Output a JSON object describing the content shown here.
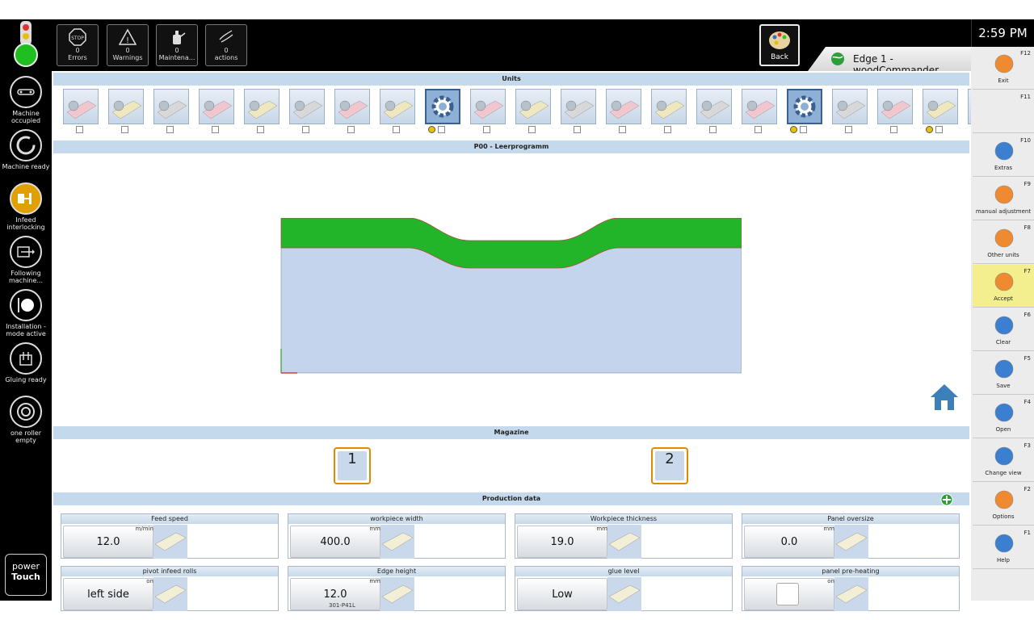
{
  "topbar": {
    "buttons": [
      {
        "icon": "stop-icon",
        "count": "0",
        "label": "Errors"
      },
      {
        "icon": "warning-icon",
        "count": "0",
        "label": "Warnings"
      },
      {
        "icon": "oilcan-icon",
        "count": "0",
        "label": "Maintena..."
      },
      {
        "icon": "hand-icon",
        "count": "0",
        "label": "actions"
      }
    ],
    "back_label": "Back",
    "window_tab": "Edge 1 - woodCommander",
    "clock": "2:59 PM"
  },
  "leftbar": {
    "items": [
      {
        "icon": "conveyor-icon",
        "label": "Machine occupied"
      },
      {
        "icon": "ready-ring-icon",
        "label": "Machine ready"
      },
      {
        "icon": "infeed-icon",
        "label": "Infeed interlocking"
      },
      {
        "icon": "following-machine-icon",
        "label": "Following machine..."
      },
      {
        "icon": "installation-icon",
        "label": "Installation - mode active"
      },
      {
        "icon": "glue-pot-icon",
        "label": "Gluing ready"
      },
      {
        "icon": "roller-icon",
        "label": "one roller empty"
      }
    ],
    "brand_line1": "power",
    "brand_line2": "Touch"
  },
  "main": {
    "units_title": "Units",
    "program_title": "P00 - Leerprogramm",
    "magazine_title": "Magazine",
    "magazines": [
      "1",
      "2"
    ],
    "production_title": "Production data",
    "tiles": [
      {
        "caption": "Feed speed",
        "unit": "m/min",
        "value": "12.0",
        "sub": ""
      },
      {
        "caption": "workpiece width",
        "unit": "mm",
        "value": "400.0",
        "sub": ""
      },
      {
        "caption": "Workpiece thickness",
        "unit": "mm",
        "value": "19.0",
        "sub": ""
      },
      {
        "caption": "Panel oversize",
        "unit": "mm",
        "value": "0.0",
        "sub": ""
      },
      {
        "caption": "pivot infeed rolls",
        "unit": "on",
        "value": "left side",
        "sub": ""
      },
      {
        "caption": "Edge height",
        "unit": "mm",
        "value": "12.0",
        "sub": "301-P41L"
      },
      {
        "caption": "glue level",
        "unit": "",
        "value": "Low",
        "sub": ""
      },
      {
        "caption": "panel pre-heating",
        "unit": "on",
        "value": "",
        "sub": ""
      }
    ]
  },
  "units": [
    {
      "selected": false,
      "dot": false
    },
    {
      "selected": false,
      "dot": false
    },
    {
      "selected": false,
      "dot": false
    },
    {
      "selected": false,
      "dot": false
    },
    {
      "selected": false,
      "dot": false
    },
    {
      "selected": false,
      "dot": false
    },
    {
      "selected": false,
      "dot": false
    },
    {
      "selected": false,
      "dot": false
    },
    {
      "selected": true,
      "dot": true
    },
    {
      "selected": false,
      "dot": false
    },
    {
      "selected": false,
      "dot": false
    },
    {
      "selected": false,
      "dot": false
    },
    {
      "selected": false,
      "dot": false
    },
    {
      "selected": false,
      "dot": false
    },
    {
      "selected": false,
      "dot": false
    },
    {
      "selected": false,
      "dot": false
    },
    {
      "selected": true,
      "dot": true
    },
    {
      "selected": false,
      "dot": false
    },
    {
      "selected": false,
      "dot": false
    },
    {
      "selected": false,
      "dot": true
    },
    {
      "selected": false,
      "dot": false
    }
  ],
  "rightbar": {
    "items": [
      {
        "key": "F12",
        "label": "Exit",
        "icon": "exit-icon"
      },
      {
        "key": "F11",
        "label": "",
        "icon": ""
      },
      {
        "key": "F10",
        "label": "Extras",
        "icon": "extras-icon"
      },
      {
        "key": "F9",
        "label": "manual adjustment",
        "icon": "manual-adjustment-icon"
      },
      {
        "key": "F8",
        "label": "Other units",
        "icon": "other-units-icon"
      },
      {
        "key": "F7",
        "label": "Accept",
        "icon": "accept-icon"
      },
      {
        "key": "F6",
        "label": "Clear",
        "icon": "clear-icon"
      },
      {
        "key": "F5",
        "label": "Save",
        "icon": "save-icon"
      },
      {
        "key": "F4",
        "label": "Open",
        "icon": "open-icon"
      },
      {
        "key": "F3",
        "label": "Change view",
        "icon": "change-view-icon"
      },
      {
        "key": "F2",
        "label": "Options",
        "icon": "options-icon"
      },
      {
        "key": "F1",
        "label": "Help",
        "icon": "help-icon"
      }
    ]
  },
  "colors": {
    "edge_band": "#22b52a",
    "panel": "#c3d4ec",
    "accent_active": "#f3ee8e",
    "header": "#c5d9ec"
  }
}
